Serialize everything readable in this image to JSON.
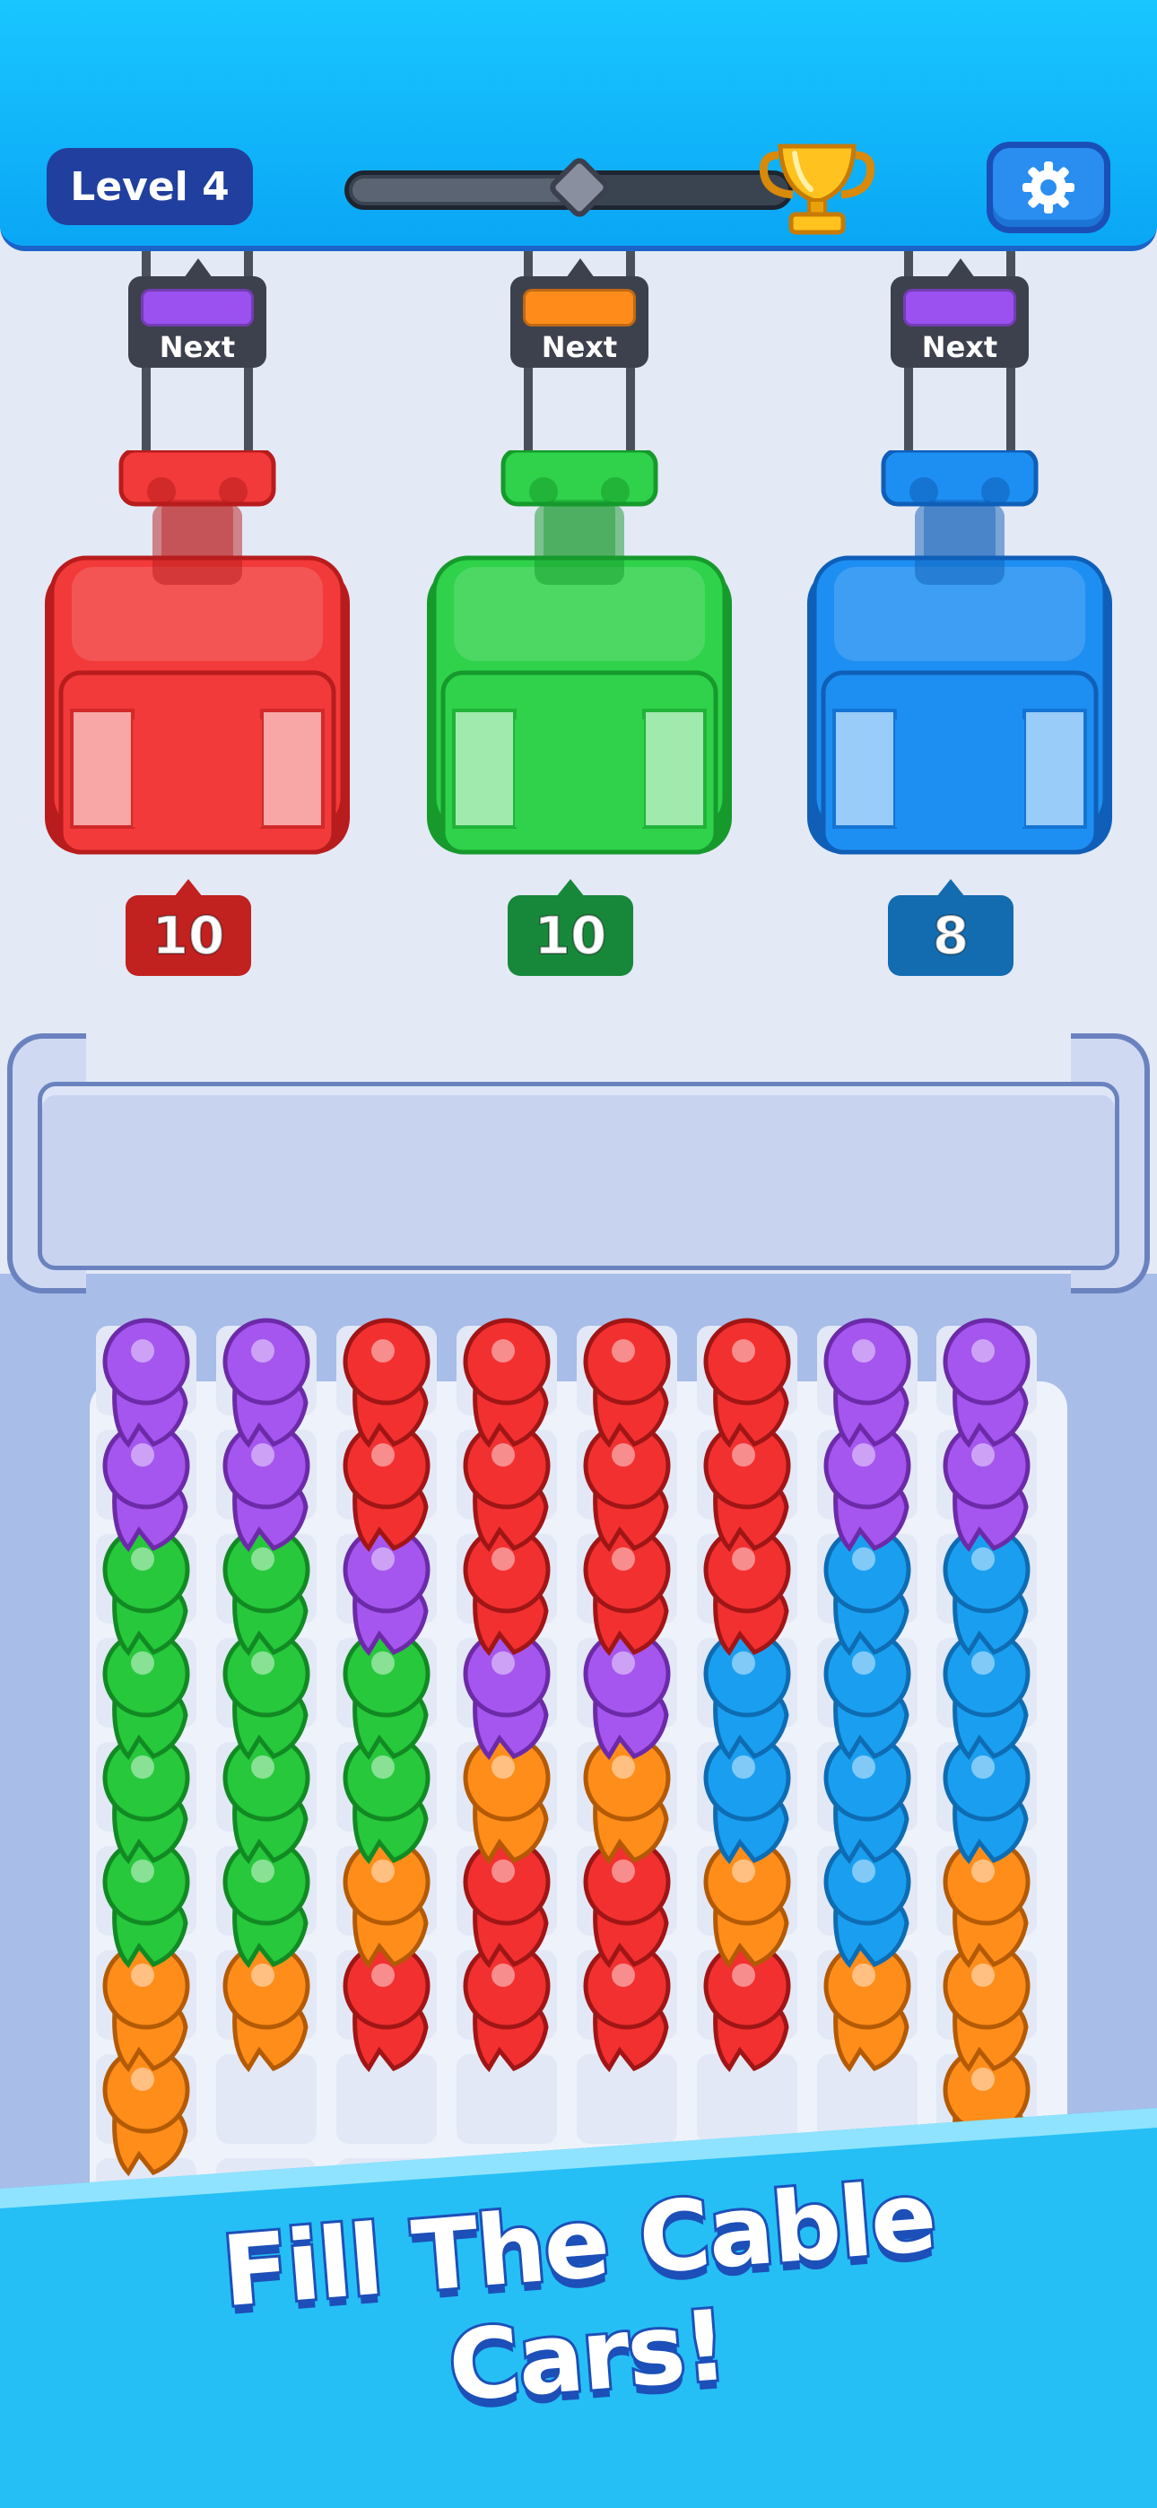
{
  "header": {
    "level_label": "Level 4",
    "progress": 0.55,
    "trophy_icon": "trophy-icon",
    "settings_icon": "gear-icon"
  },
  "cable_cars": [
    {
      "color": "#f23a3a",
      "dark": "#b81c1c",
      "next_label": "Next",
      "next_color": "#9b51f0",
      "count": "10",
      "badge_color": "#c1211f"
    },
    {
      "color": "#2fd24a",
      "dark": "#169a2c",
      "next_label": "Next",
      "next_color": "#ff8c1a",
      "count": "10",
      "badge_color": "#17883a"
    },
    {
      "color": "#1e8ff2",
      "dark": "#0f5fb8",
      "next_label": "Next",
      "next_color": "#9b51f0",
      "count": "8",
      "badge_color": "#136bb0"
    }
  ],
  "palette": {
    "P": "#a556ee",
    "R": "#f23030",
    "G": "#27c83c",
    "B": "#1a9ff0",
    "O": "#ff8d1a"
  },
  "queue_columns": [
    [
      "P",
      "P",
      "G",
      "G",
      "G",
      "G",
      "O",
      "O"
    ],
    [
      "P",
      "P",
      "G",
      "G",
      "G",
      "G",
      "O"
    ],
    [
      "R",
      "R",
      "P",
      "G",
      "G",
      "O",
      "R"
    ],
    [
      "R",
      "R",
      "R",
      "P",
      "O",
      "R",
      "R"
    ],
    [
      "R",
      "R",
      "R",
      "P",
      "O",
      "R",
      "R"
    ],
    [
      "R",
      "R",
      "R",
      "B",
      "B",
      "O",
      "R"
    ],
    [
      "P",
      "P",
      "B",
      "B",
      "B",
      "B",
      "O"
    ],
    [
      "P",
      "P",
      "B",
      "B",
      "B",
      "O",
      "O",
      "O"
    ]
  ],
  "banner": {
    "text": "Fill The Cable Cars!"
  }
}
